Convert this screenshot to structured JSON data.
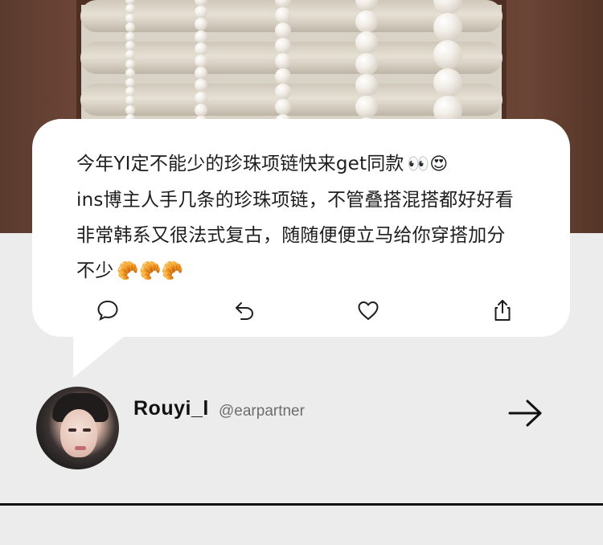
{
  "post": {
    "lines": [
      "今年YI定不能少的珍珠项链快来get同款",
      "ins博主人手几条的珍珠项链，不管叠搭混搭都好好看",
      "非常韩系又很法式复古，随随便便立马给你穿搭加分",
      "不少"
    ],
    "line1_emoji": "👀😍",
    "line4_emoji": "🥐🥐🥐"
  },
  "actions": {
    "comment_icon": "comment-icon",
    "reply_icon": "reply-icon",
    "like_icon": "heart-icon",
    "share_icon": "share-icon"
  },
  "author": {
    "name": "Rouyi_l",
    "handle": "@earpartner"
  },
  "colors": {
    "background": "#ececec",
    "card": "#ffffff",
    "text": "#1e1e1e",
    "handle": "#6d6d6d"
  }
}
